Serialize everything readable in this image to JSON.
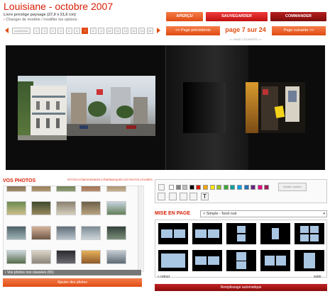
{
  "header": {
    "title": "Louisiane - octobre 2007",
    "subtitle": "Livre prestige paysage (27,9 x 21,6 cm)",
    "change_link": "Changer de modèle / modifier les options"
  },
  "actions": {
    "apercu": "APERÇU",
    "sauvegarder": "SAUVEGARDER",
    "commander": "COMMANDER"
  },
  "page_nav": {
    "cover_label": "couverture",
    "pages": [
      "1",
      "2",
      "3",
      "4",
      "5",
      "6",
      "7",
      "8",
      "9",
      "10",
      "11",
      "12",
      "13",
      "14",
      "15"
    ],
    "active_page": "7",
    "prev_label": "<< Page précédente",
    "next_label": "Page suivante >>",
    "page_counter": "page 7 sur 24",
    "cover_view_label": "<< PAGE COUVERTE >>"
  },
  "photos": {
    "title": "VOS PHOTOS",
    "size_options": [
      "PETITES ICÔNES",
      "GRANDES ICÔNES",
      "MASQUER LES PHOTOS UTILISÉES"
    ],
    "unclassified": "Vos photos non classées (55)",
    "add_button": "Ajouter des photos"
  },
  "tools": {
    "swatch_colors": [
      "#ffffff",
      "#808080",
      "#c0c0c0",
      "#000000",
      "#d81e05",
      "#f7a600",
      "#ffe600",
      "#96c11f",
      "#3aaa35",
      "#00a19a",
      "#009fe3",
      "#1d71b8",
      "#662483",
      "#e6007e",
      "#a2195b"
    ],
    "fill_label": "choisir couleur"
  },
  "layout": {
    "title": "MISE EN PAGE",
    "selected": "> Simple - fond noir",
    "retour": "retour",
    "suite": "suite",
    "auto_fill": "Remplissage automatique"
  },
  "colors": {
    "accent_red": "#d81e05",
    "accent_orange": "#e04b12",
    "dark_red": "#8a0b0b",
    "layout_block": "#a9c6e3"
  }
}
